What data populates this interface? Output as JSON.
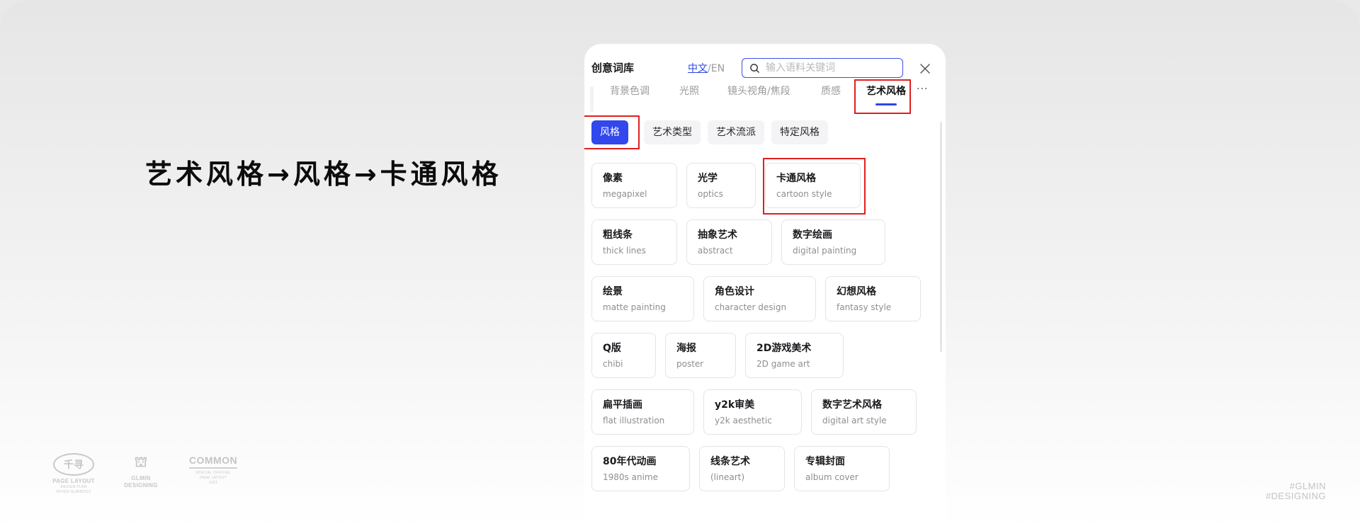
{
  "heading": "艺术风格→风格→卡通风格",
  "logos": [
    {
      "mark": "千寻",
      "line1": "PAGE LAYOUT",
      "line2": "DESIGN PLAN",
      "line3": "OFFER GLMIN2021"
    },
    {
      "mark": "⛫",
      "line1": "GLMIN",
      "line2": "DESIGNING"
    },
    {
      "mark": "COMMON",
      "line1": "SPECIAL OFFICIAL",
      "line2": "PAGE LAYOUT",
      "line3": "2021"
    }
  ],
  "hashtags": [
    "#GLMIN",
    "#DESIGNING"
  ],
  "panel": {
    "title": "创意词库",
    "lang_active": "中文",
    "lang_sep": "/",
    "lang_other": "EN",
    "search_placeholder": "输入语料关键词",
    "tabs": [
      {
        "label": "背景色调",
        "active": false
      },
      {
        "label": "光照",
        "active": false
      },
      {
        "label": "镜头视角/焦段",
        "active": false
      },
      {
        "label": "质感",
        "active": false
      },
      {
        "label": "艺术风格",
        "active": true
      }
    ],
    "more": "···",
    "subtabs": [
      {
        "label": "风格",
        "active": true
      },
      {
        "label": "艺术类型",
        "active": false
      },
      {
        "label": "艺术流派",
        "active": false
      },
      {
        "label": "特定风格",
        "active": false
      }
    ],
    "cards": [
      [
        {
          "zh": "像素",
          "en": "megapixel"
        },
        {
          "zh": "光学",
          "en": "optics"
        },
        {
          "zh": "卡通风格",
          "en": "cartoon style"
        }
      ],
      [
        {
          "zh": "粗线条",
          "en": "thick lines"
        },
        {
          "zh": "抽象艺术",
          "en": "abstract"
        },
        {
          "zh": "数字绘画",
          "en": "digital painting"
        }
      ],
      [
        {
          "zh": "绘景",
          "en": "matte painting"
        },
        {
          "zh": "角色设计",
          "en": "character design"
        },
        {
          "zh": "幻想风格",
          "en": "fantasy style"
        }
      ],
      [
        {
          "zh": "Q版",
          "en": "chibi"
        },
        {
          "zh": "海报",
          "en": "poster"
        },
        {
          "zh": "2D游戏美术",
          "en": "2D game art"
        }
      ],
      [
        {
          "zh": "扁平插画",
          "en": "flat illustration"
        },
        {
          "zh": "y2k审美",
          "en": "y2k aesthetic"
        },
        {
          "zh": "数字艺术风格",
          "en": "digital art style"
        }
      ],
      [
        {
          "zh": "80年代动画",
          "en": "1980s anime"
        },
        {
          "zh": "线条艺术",
          "en": "(lineart)"
        },
        {
          "zh": "专辑封面",
          "en": "album cover"
        }
      ]
    ]
  },
  "colors": {
    "accent": "#3247ec",
    "highlight": "#e01f1f",
    "text": "#1b1b1f",
    "muted": "#8e8e93"
  }
}
